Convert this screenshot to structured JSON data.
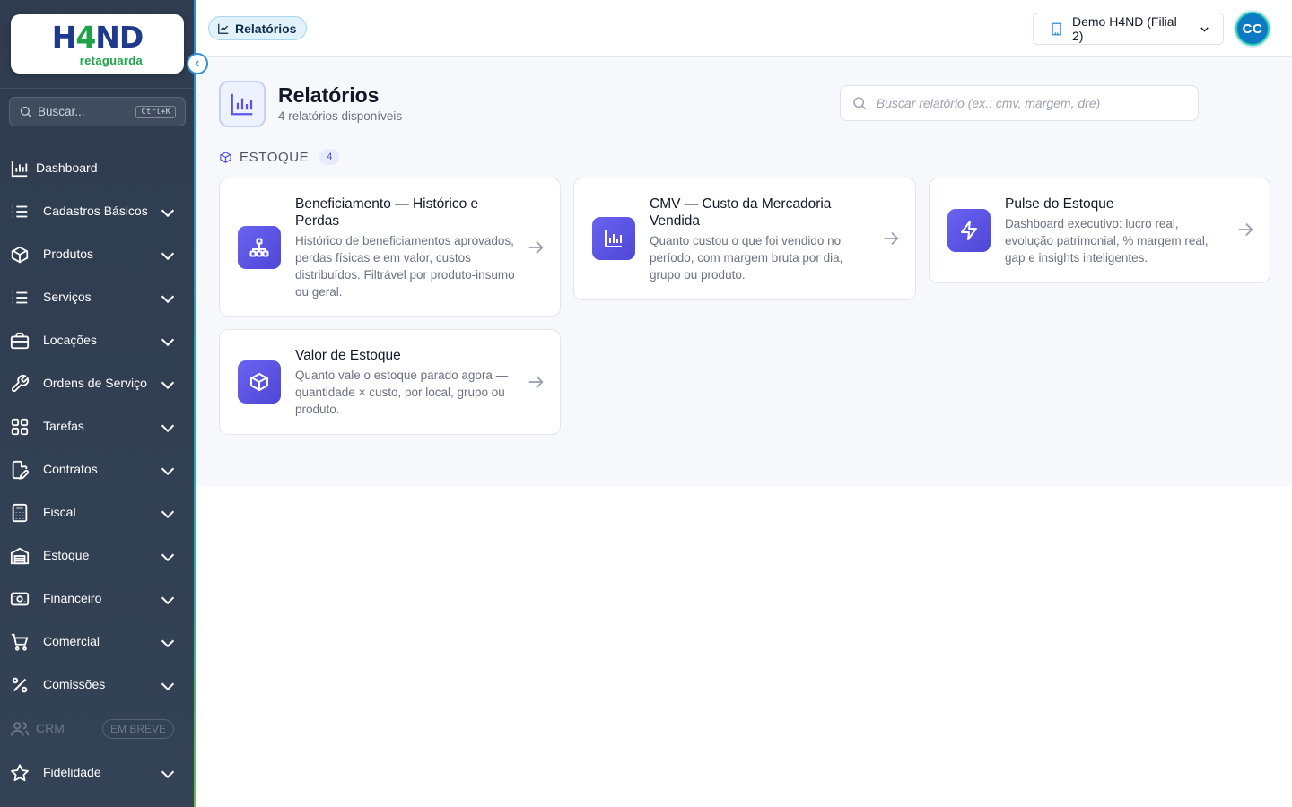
{
  "brand": {
    "logo_prefix": "H",
    "logo_four": "4",
    "logo_suffix": "ND",
    "logo_sub": "retaguarda",
    "primary": "#1f3a8a",
    "accent": "#1fa34a"
  },
  "sidebar": {
    "search_placeholder": "Buscar...",
    "search_shortcut": "Ctrl+K",
    "items": [
      {
        "label": "Dashboard",
        "icon": "bar-chart-icon",
        "expandable": false
      },
      {
        "label": "Cadastros Básicos",
        "icon": "list-icon",
        "expandable": true
      },
      {
        "label": "Produtos",
        "icon": "box-icon",
        "expandable": true
      },
      {
        "label": "Serviços",
        "icon": "list-icon",
        "expandable": true
      },
      {
        "label": "Locações",
        "icon": "briefcase-icon",
        "expandable": true
      },
      {
        "label": "Ordens de Serviço",
        "icon": "wrench-icon",
        "expandable": true
      },
      {
        "label": "Tarefas",
        "icon": "grid-icon",
        "expandable": true
      },
      {
        "label": "Contratos",
        "icon": "document-pen-icon",
        "expandable": true
      },
      {
        "label": "Fiscal",
        "icon": "calculator-icon",
        "expandable": true
      },
      {
        "label": "Estoque",
        "icon": "warehouse-icon",
        "expandable": true
      },
      {
        "label": "Financeiro",
        "icon": "cash-icon",
        "expandable": true
      },
      {
        "label": "Comercial",
        "icon": "cart-icon",
        "expandable": true
      },
      {
        "label": "Comissões",
        "icon": "percent-icon",
        "expandable": true
      },
      {
        "label": "CRM",
        "icon": "users-icon",
        "badge": "EM BREVE",
        "disabled": true
      },
      {
        "label": "Fidelidade",
        "icon": "star-icon",
        "expandable": true
      }
    ]
  },
  "topbar": {
    "breadcrumb": "Relatórios",
    "branch": "Demo H4ND (Filial 2)",
    "avatar_initials": "CC"
  },
  "page": {
    "title": "Relatórios",
    "subtitle": "4 relatórios disponíveis",
    "search_placeholder": "Buscar relatório (ex.: cmv, margem, dre)"
  },
  "section": {
    "name": "ESTOQUE",
    "count": "4"
  },
  "cards": [
    {
      "title": "Beneficiamento — Histórico e Perdas",
      "description": "Histórico de beneficiamentos aprovados, perdas físicas e em valor, custos distribuídos. Filtrável por produto-insumo ou geral.",
      "icon": "hierarchy-icon"
    },
    {
      "title": "CMV — Custo da Mercadoria Vendida",
      "description": "Quanto custou o que foi vendido no período, com margem bruta por dia, grupo ou produto.",
      "icon": "bar-chart-icon"
    },
    {
      "title": "Pulse do Estoque",
      "description": "Dashboard executivo: lucro real, evolução patrimonial, % margem real, gap e insights inteligentes.",
      "icon": "bolt-icon"
    },
    {
      "title": "Valor de Estoque",
      "description": "Quanto vale o estoque parado agora — quantidade × custo, por local, grupo ou produto.",
      "icon": "cube-icon"
    }
  ],
  "colors": {
    "sidebar_bg": "#2f3c4f",
    "card_icon": "#5b54e6",
    "breadcrumb_bg": "#e2f2fb"
  }
}
